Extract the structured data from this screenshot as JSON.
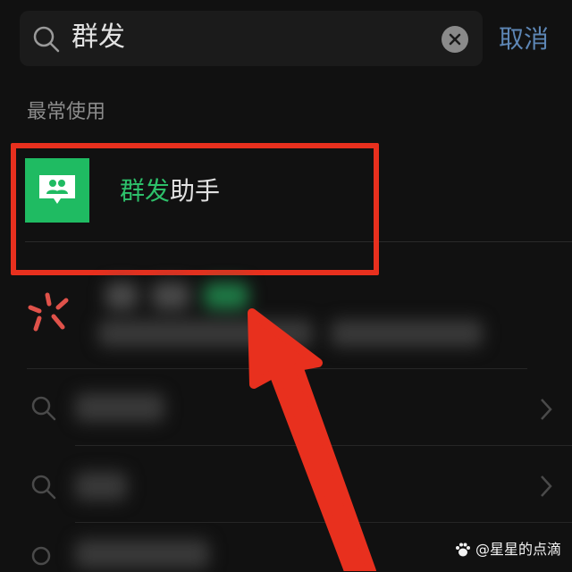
{
  "search": {
    "query": "群发",
    "cancel_label": "取消"
  },
  "section": {
    "label": "最常使用"
  },
  "result": {
    "title_highlight": "群发",
    "title_rest": "助手"
  },
  "colors": {
    "background": "#111111",
    "accent_green": "#2dc06a",
    "cancel_blue": "#5d86b5",
    "annotation_red": "#e8301e"
  },
  "watermark": {
    "text": "@星星的点滴"
  }
}
